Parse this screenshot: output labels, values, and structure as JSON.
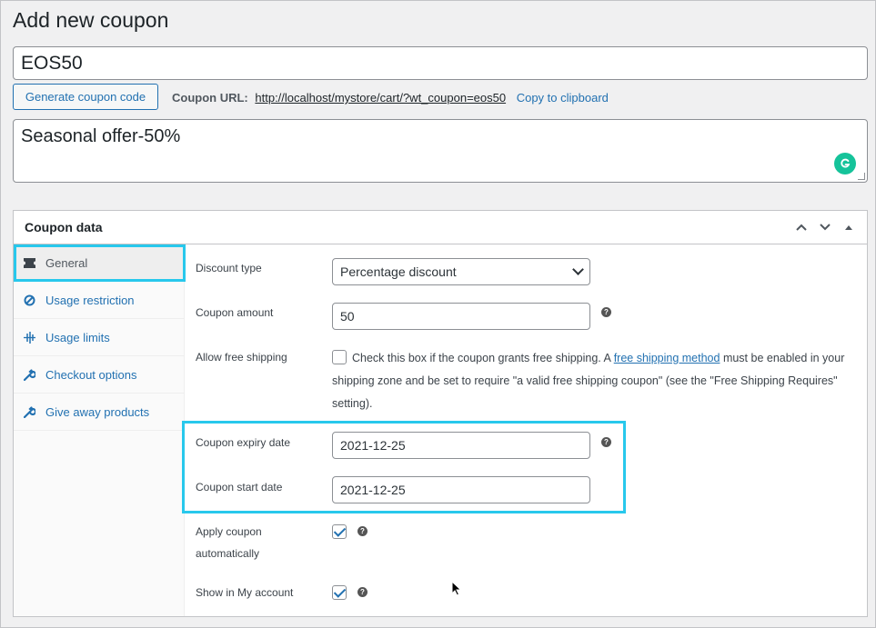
{
  "page": {
    "title": "Add new coupon"
  },
  "coupon": {
    "code": "EOS50",
    "generate_button": "Generate coupon code",
    "url_label": "Coupon URL:",
    "url": "http://localhost/mystore/cart/?wt_coupon=eos50",
    "copy_label": "Copy to clipboard",
    "description": "Seasonal offer-50%"
  },
  "panel": {
    "title": "Coupon data",
    "tabs": [
      {
        "label": "General",
        "icon": "ticket-icon"
      },
      {
        "label": "Usage restriction",
        "icon": "block-icon"
      },
      {
        "label": "Usage limits",
        "icon": "limits-icon"
      },
      {
        "label": "Checkout options",
        "icon": "wrench-icon"
      },
      {
        "label": "Give away products",
        "icon": "wrench-icon"
      }
    ]
  },
  "general": {
    "discount_type_label": "Discount type",
    "discount_type_value": "Percentage discount",
    "amount_label": "Coupon amount",
    "amount_value": "50",
    "free_shipping_label": "Allow free shipping",
    "free_shipping_text_1": "Check this box if the coupon grants free shipping. A",
    "free_shipping_link": "free shipping method",
    "free_shipping_text_2": "must be enabled in your shipping zone and be set to require \"a valid free shipping coupon\" (see the \"Free Shipping Requires\" setting).",
    "expiry_label": "Coupon expiry date",
    "expiry_value": "2021-12-25",
    "start_label": "Coupon start date",
    "start_value": "2021-12-25",
    "apply_auto_label_1": "Apply coupon",
    "apply_auto_label_2": "automatically",
    "show_account_label": "Show in My account"
  },
  "colors": {
    "accent": "#2271b1",
    "highlight": "#28c8ec",
    "grammarly": "#15c39a"
  }
}
